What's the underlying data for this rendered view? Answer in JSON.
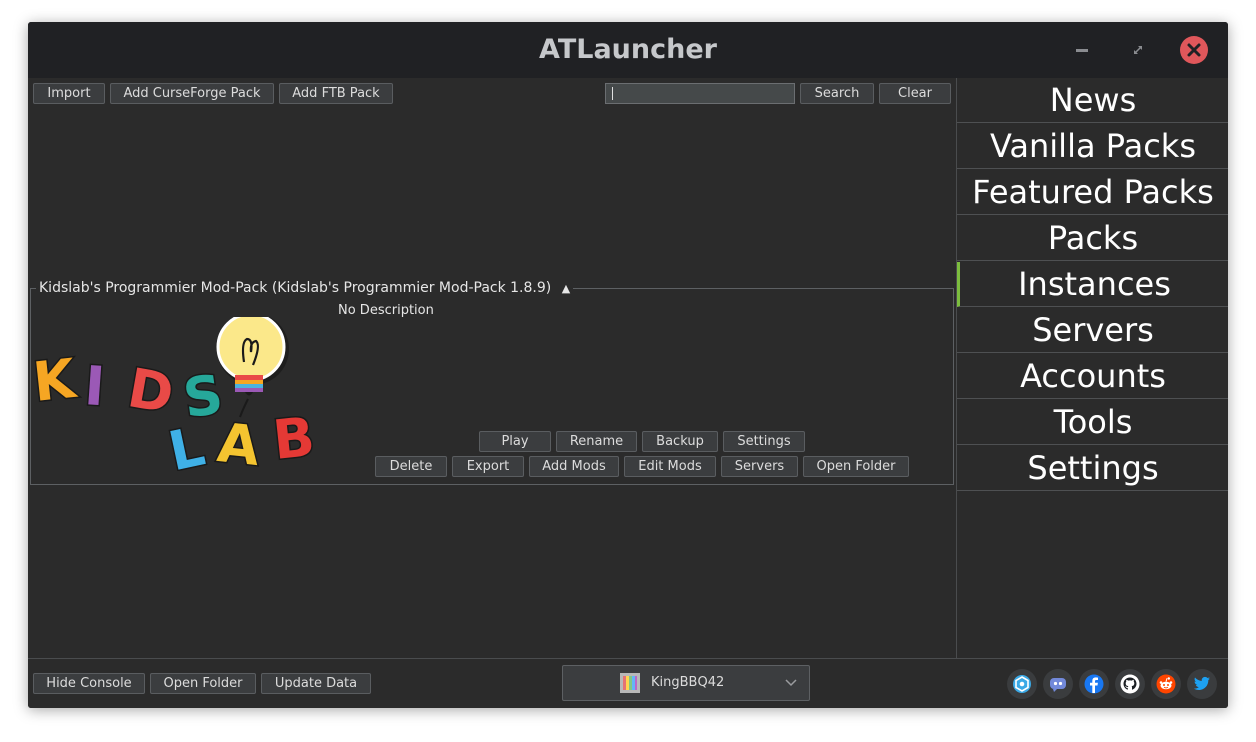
{
  "window": {
    "title": "ATLauncher"
  },
  "toolbar": {
    "import": "Import",
    "add_curseforge": "Add CurseForge Pack",
    "add_ftb": "Add FTB Pack",
    "search_value": "",
    "search": "Search",
    "clear": "Clear"
  },
  "sidebar": {
    "tabs": [
      {
        "label": "News"
      },
      {
        "label": "Vanilla Packs"
      },
      {
        "label": "Featured Packs"
      },
      {
        "label": "Packs"
      },
      {
        "label": "Instances",
        "active": true
      },
      {
        "label": "Servers"
      },
      {
        "label": "Accounts"
      },
      {
        "label": "Tools"
      },
      {
        "label": "Settings"
      }
    ]
  },
  "instance": {
    "title": "Kidslab's Programmier Mod-Pack (Kidslab's Programmier Mod-Pack 1.8.9)",
    "collapse_glyph": "▲",
    "description": "No Description",
    "logo_letters": [
      "K",
      "I",
      "D",
      "S",
      "L",
      "A",
      "B"
    ],
    "buttons_row1": [
      "Play",
      "Rename",
      "Backup",
      "Settings"
    ],
    "buttons_row2": [
      "Delete",
      "Export",
      "Add Mods",
      "Edit Mods",
      "Servers",
      "Open Folder"
    ]
  },
  "bottom": {
    "hide_console": "Hide Console",
    "open_folder": "Open Folder",
    "update_data": "Update Data",
    "account": "KingBBQ42",
    "social_icons": [
      "nodecraft-icon",
      "discord-icon",
      "facebook-icon",
      "github-icon",
      "reddit-icon",
      "twitter-icon"
    ]
  },
  "colors": {
    "background": "#2b2b2b",
    "titlebar": "#202124",
    "active_tab_accent": "#7cbd3e",
    "close_button": "#e0575b"
  }
}
